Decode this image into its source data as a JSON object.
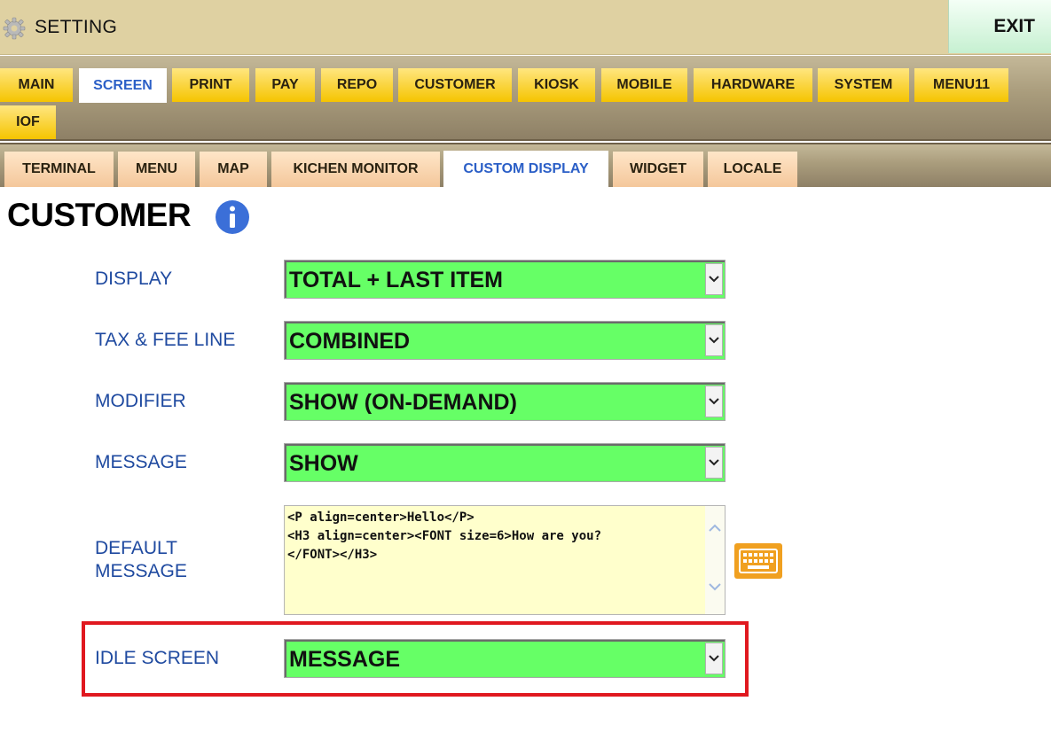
{
  "titlebar": {
    "title": "SETTING",
    "exit_label": "EXIT"
  },
  "main_tabs": [
    "MAIN",
    "SCREEN",
    "PRINT",
    "PAY",
    "REPO",
    "CUSTOMER",
    "KIOSK",
    "MOBILE",
    "HARDWARE",
    "SYSTEM",
    "MENU11",
    "IOF"
  ],
  "sub_tabs": [
    "TERMINAL",
    "MENU",
    "MAP",
    "KICHEN MONITOR",
    "CUSTOM DISPLAY",
    "WIDGET",
    "LOCALE"
  ],
  "section_title": "CUSTOMER",
  "fields": {
    "display": {
      "label": "DISPLAY",
      "value": "TOTAL + LAST ITEM"
    },
    "tax_fee": {
      "label": "TAX & FEE LINE",
      "value": "COMBINED"
    },
    "modifier": {
      "label": "MODIFIER",
      "value": "SHOW (ON-DEMAND)"
    },
    "message": {
      "label": "MESSAGE",
      "value": "SHOW"
    },
    "default_message": {
      "label_line1": "DEFAULT",
      "label_line2": "MESSAGE",
      "value": "<P align=center>Hello</P>\n<H3 align=center><FONT size=6>How are you?\n</FONT></H3>"
    },
    "idle_screen": {
      "label": "IDLE SCREEN",
      "value": "MESSAGE"
    }
  },
  "colors": {
    "select_bg": "#66ff66",
    "textarea_bg": "#ffffcc",
    "label": "#1f4aa0",
    "highlight": "#e0181f",
    "tab_yellow": "#f5c400",
    "tab_orange": "#f4c79b"
  }
}
